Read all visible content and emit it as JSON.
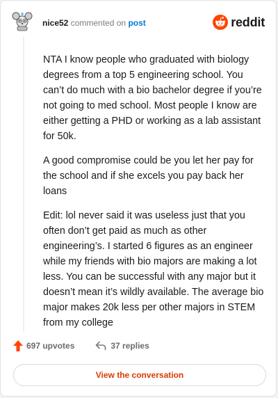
{
  "header": {
    "username": "nice52",
    "action_text": "commented on",
    "post_link": "post"
  },
  "logo": {
    "wordmark": "reddit",
    "icon": "reddit-snoo-icon",
    "brand_color": "#ff4500"
  },
  "comment": {
    "paragraphs": [
      "NTA I know people who graduated with biology degrees from a top 5 engineering school. You can’t do much with a bio bachelor degree if you’re not going to med school. Most people I know are either getting a PHD or working as a lab assistant for 50k.",
      "A good compromise could be you let her pay for the school and if she excels you pay back her loans",
      "Edit: lol never said it was useless just that you often don’t get paid as much as other engineering’s. I started 6 figures as an engineer while my friends with bio majors are making a lot less. You can be successful with any major but it doesn’t mean it’s wildly available. The average bio major makes 20k less per other majors in STEM from my college"
    ]
  },
  "footer": {
    "upvotes": "697 upvotes",
    "replies": "37 replies",
    "upvote_color": "#ff4500"
  },
  "cta": {
    "label": "View the conversation"
  }
}
